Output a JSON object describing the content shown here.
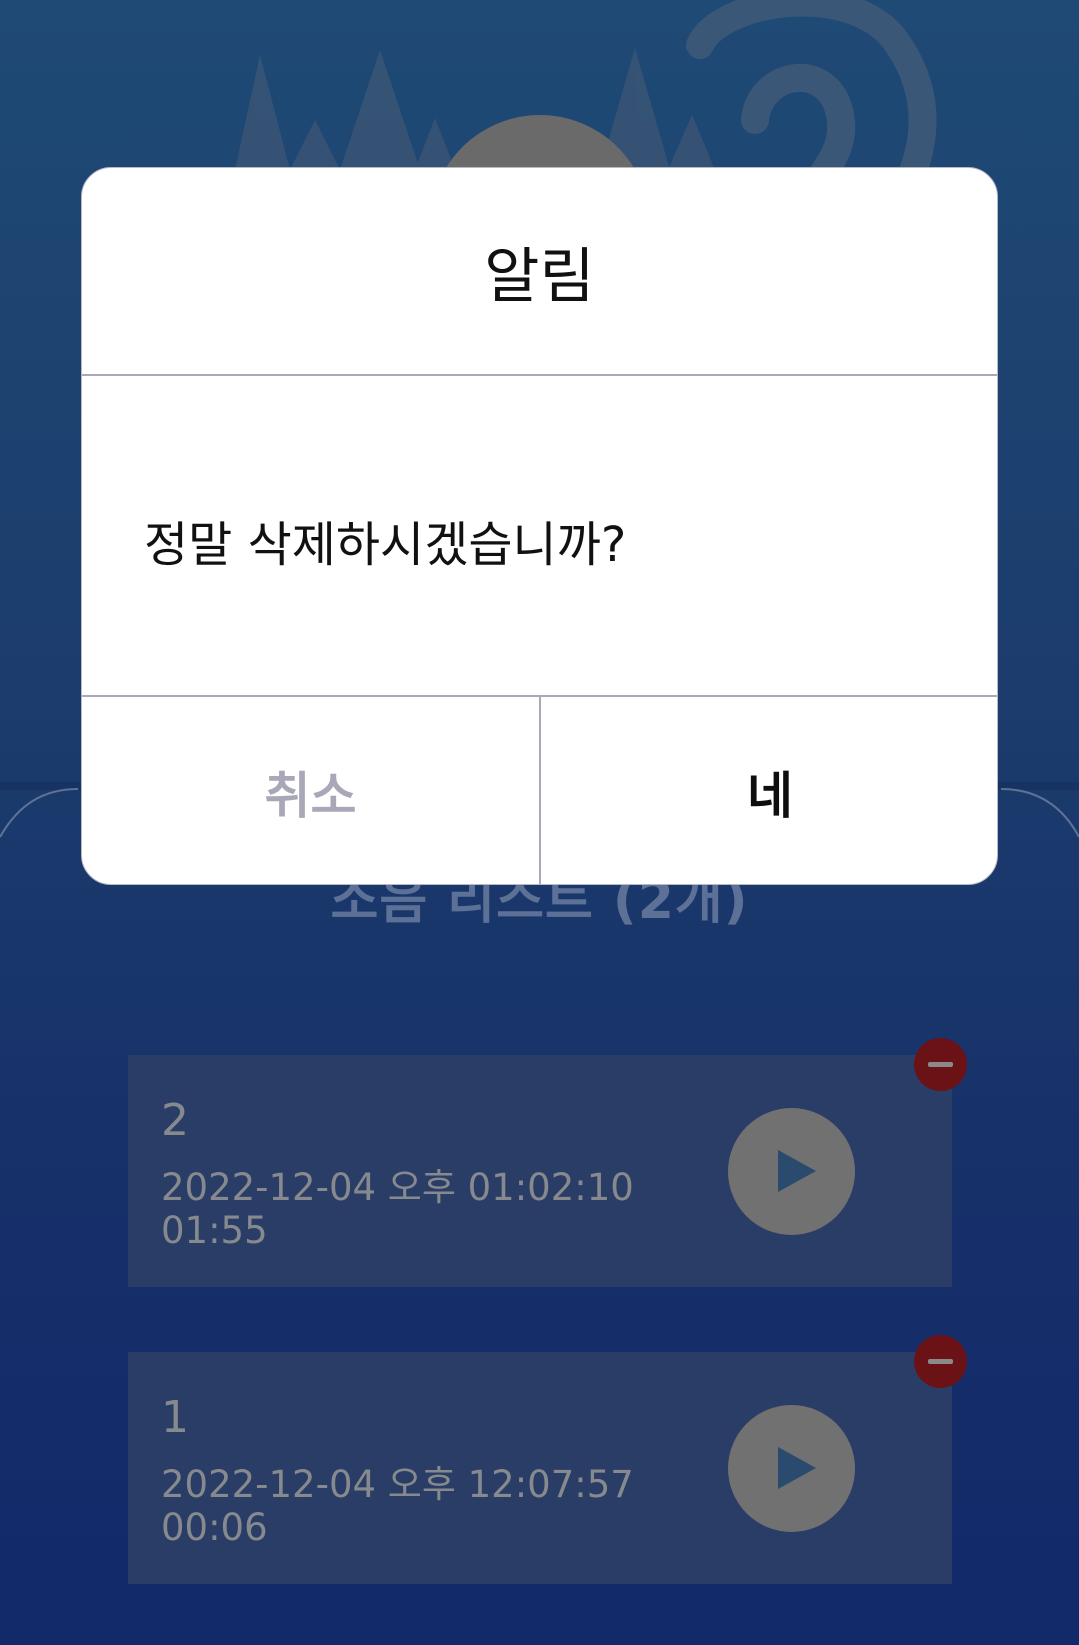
{
  "record_list": {
    "title": "소음 리스트 (2개)",
    "items": [
      {
        "name": "2",
        "date": "2022-12-04 오후 01:02:10",
        "duration": "01:55"
      },
      {
        "name": "1",
        "date": "2022-12-04 오후 12:07:57",
        "duration": "00:06"
      }
    ]
  },
  "dialog": {
    "title": "알림",
    "message": "정말 삭제하시겠습니까?",
    "cancel_label": "취소",
    "confirm_label": "네"
  },
  "icons": {
    "play": "play-icon",
    "delete": "minus-circle-icon",
    "ear": "ear-icon"
  },
  "colors": {
    "background": "#1b3b6c",
    "card": "#2a3d66",
    "delete_badge": "#6b1216",
    "play_button": "#717171",
    "dialog_background": "#ffffff",
    "cancel_text": "#a8a8b8",
    "confirm_text": "#0e0e0e"
  }
}
